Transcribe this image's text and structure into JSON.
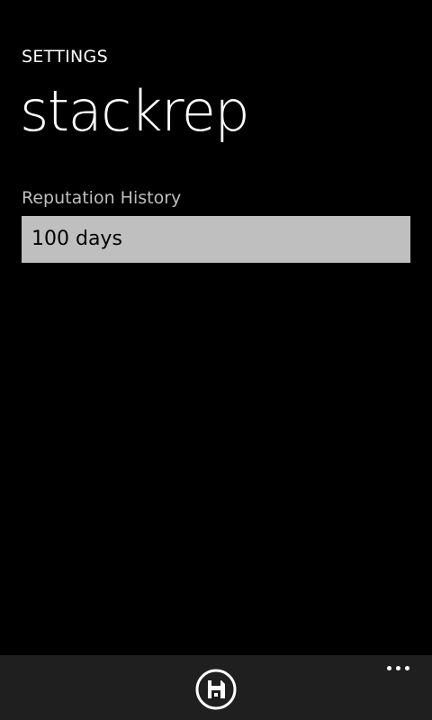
{
  "header": {
    "app_title": "SETTINGS",
    "page_title": "stackrep"
  },
  "settings": {
    "reputation_history": {
      "label": "Reputation History",
      "value": "100 days"
    }
  },
  "app_bar": {
    "buttons": [
      {
        "icon": "save-icon"
      }
    ],
    "more_icon": "ellipsis-icon"
  },
  "colors": {
    "background": "#000000",
    "app_bar": "#1f1f1f",
    "picker_background": "#bfbfbf",
    "label": "#bfbfbf"
  }
}
